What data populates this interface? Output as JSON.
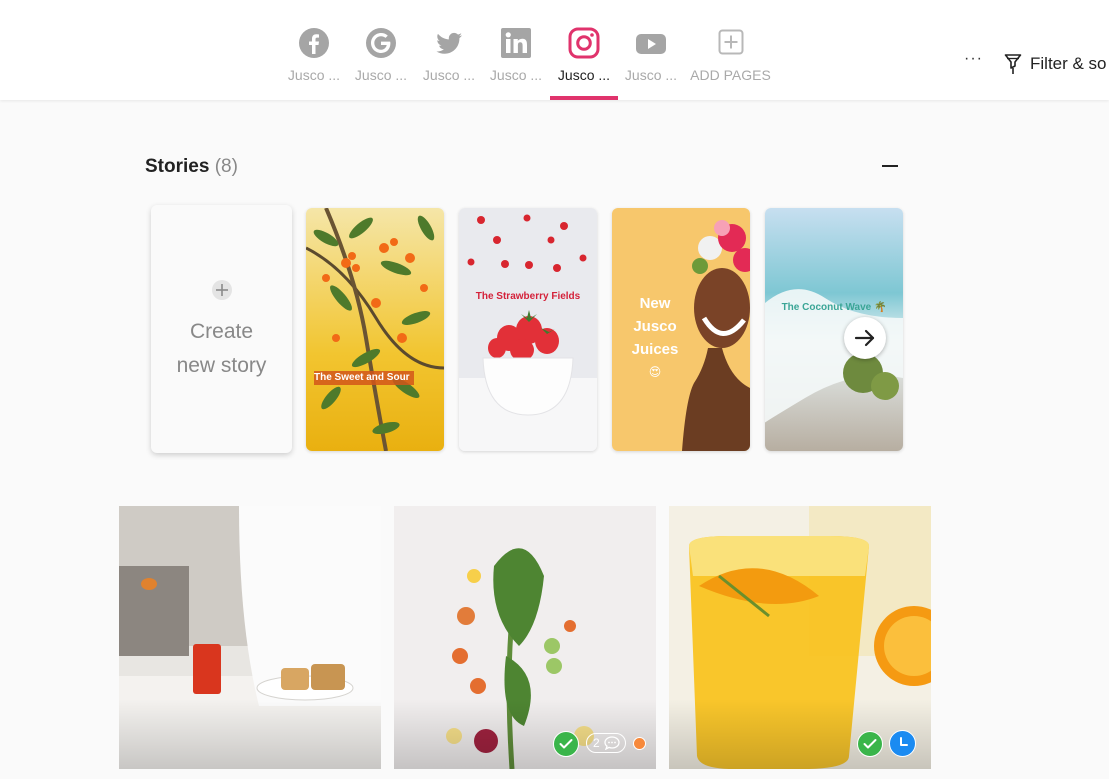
{
  "header": {
    "tabs": [
      {
        "network": "facebook",
        "icon": "facebook-icon",
        "label": "Jusco ..."
      },
      {
        "network": "google",
        "icon": "google-icon",
        "label": "Jusco ..."
      },
      {
        "network": "twitter",
        "icon": "twitter-icon",
        "label": "Jusco ..."
      },
      {
        "network": "linkedin",
        "icon": "linkedin-icon",
        "label": "Jusco ..."
      },
      {
        "network": "instagram",
        "icon": "instagram-icon",
        "label": "Jusco ...",
        "active": true
      },
      {
        "network": "youtube",
        "icon": "youtube-icon",
        "label": "Jusco ..."
      },
      {
        "network": "add",
        "icon": "plus-square-icon",
        "label": "ADD PAGES"
      }
    ],
    "more_label": "···",
    "filter_label": "Filter & so",
    "accent_color": "#e0336c"
  },
  "stories": {
    "title": "Stories",
    "count": "(8)",
    "create_line1": "Create",
    "create_line2": "new story",
    "items": [
      {
        "caption": "The Sweet and Sour"
      },
      {
        "caption": "The Strawberry Fields"
      },
      {
        "caption_line1": "New",
        "caption_line2": "Jusco",
        "caption_line3": "Juices",
        "emoji": "😍"
      },
      {
        "caption": "The Coconut Wave 🌴"
      }
    ]
  },
  "posts": [
    {
      "subject": "woman with juice and sandwich",
      "status": []
    },
    {
      "subject": "kale and vegetables",
      "status": [
        "approved",
        "comments",
        "pending-dot"
      ],
      "comment_count": "2"
    },
    {
      "subject": "orange juice glass",
      "status": [
        "approved",
        "scheduled"
      ]
    }
  ],
  "colors": {
    "approved": "#3ab54a",
    "scheduled": "#1b8bf1",
    "pending": "#f7893b"
  }
}
